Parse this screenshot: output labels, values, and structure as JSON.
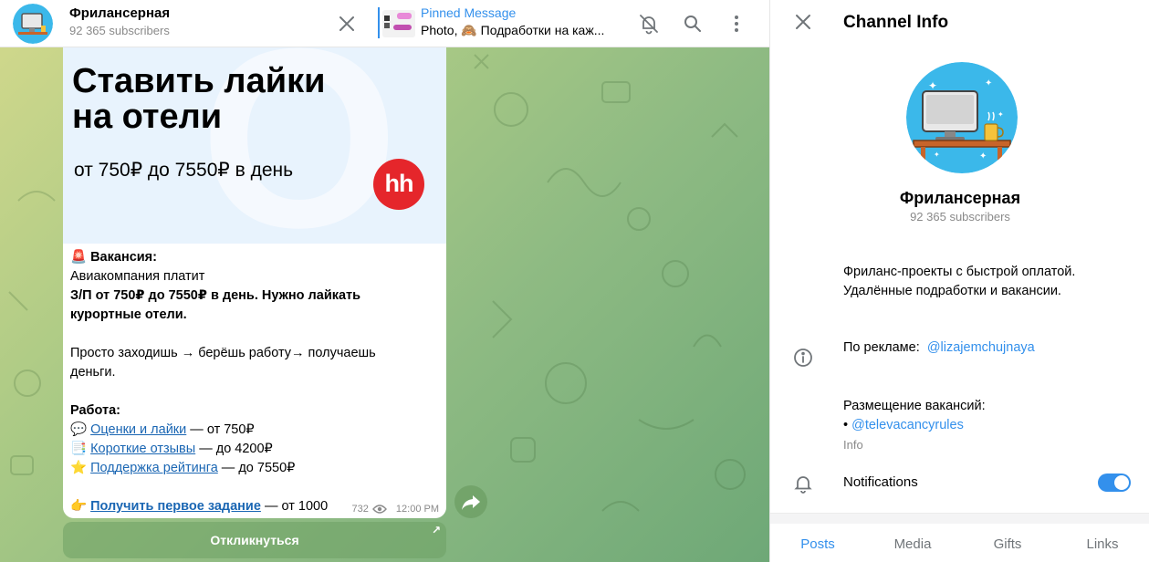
{
  "chat_header": {
    "channel_name": "Фрилансерная",
    "subscribers": "92 365 subscribers",
    "pinned_title": "Pinned Message",
    "pinned_text": "Photo, 🙈 Подработки на каж..."
  },
  "banner": {
    "title_line1": "Ставить лайки",
    "title_line2": "на отели",
    "subtitle": "от 750₽ до 7550₽ в день",
    "logo_text": "hh"
  },
  "message": {
    "vacancy_label": "🚨 Вакансия:",
    "line1": "Авиакомпания платит",
    "line2": "З/П от 750₽ до 7550₽ в день. Нужно лайкать",
    "line3": "курортные отели.",
    "line4": "Просто заходишь → берёшь работу→ получаешь",
    "line5": "деньги.",
    "work_label": "Работа:",
    "items": [
      {
        "emoji": "💬",
        "link": "Оценки и лайки",
        "rest": " — от 750₽"
      },
      {
        "emoji": "📑",
        "link": "Короткие отзывы",
        "rest": " — до 4200₽"
      },
      {
        "emoji": "⭐",
        "link": "Поддержка рейтинга",
        "rest": " — до 7550₽"
      }
    ],
    "cta_emoji": "👉",
    "cta_link": "Получить первое задание",
    "cta_rest": " — от 1000",
    "views": "732",
    "time": "12:00 PM"
  },
  "reply_button": "Откликнуться",
  "panel": {
    "title": "Channel Info",
    "channel_name": "Фрилансерная",
    "subscribers": "92 365 subscribers",
    "desc_line1": "Фриланс-проекты с быстрой оплатой.",
    "desc_line2": "Удалённые подработки и вакансии.",
    "ad_label": "По рекламе:",
    "ad_link": "@lizajemchujnaya",
    "vac_label": "Размещение вакансий:",
    "vac_bullet": "• ",
    "vac_link": "@televacancyrules",
    "info_label": "Info",
    "notifications_label": "Notifications",
    "notifications_on": true,
    "tabs": [
      "Posts",
      "Media",
      "Gifts",
      "Links"
    ],
    "active_tab": "Posts"
  },
  "colors": {
    "accent": "#3390ec",
    "link": "#1a66b3",
    "hh_red": "#e5262b",
    "avatar_bg": "#3bb8ea"
  }
}
